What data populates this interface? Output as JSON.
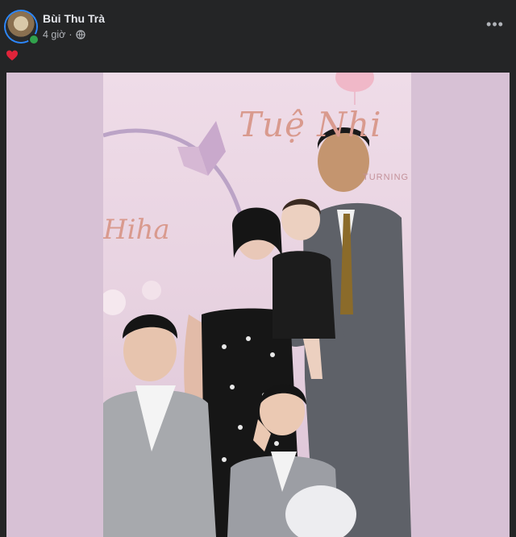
{
  "post": {
    "author": "Bùi Thu Trà",
    "time": "4 giờ",
    "separator": "·",
    "privacy_icon": "globe-icon",
    "more_label": "•••",
    "caption_icon": "heart-icon"
  },
  "photo": {
    "backdrop_text_top": "Tuệ Nhi",
    "backdrop_text_left": "Hiha",
    "backdrop_text_right": "TURNING",
    "colors": {
      "frame": "#d7c1d5",
      "backdrop": "#e8d3e1",
      "script": "#d99a8e"
    }
  }
}
